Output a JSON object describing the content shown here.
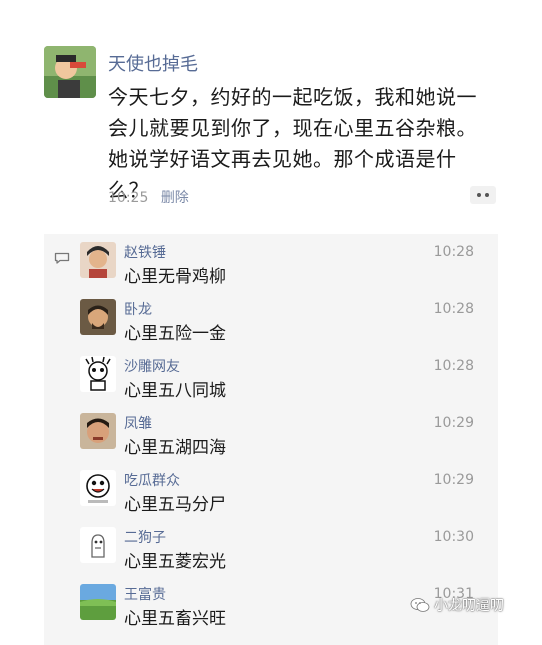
{
  "post": {
    "author": "天使也掉毛",
    "text": "今天七夕，约好的一起吃饭，我和她说一会儿就要见到你了，现在心里五谷杂粮。她说学好语文再去见她。那个成语是什么？",
    "time": "10:25",
    "delete_label": "删除"
  },
  "comments": [
    {
      "name": "赵铁锤",
      "text": "心里无骨鸡柳",
      "time": "10:28"
    },
    {
      "name": "卧龙",
      "text": "心里五险一金",
      "time": "10:28"
    },
    {
      "name": "沙雕网友",
      "text": "心里五八同城",
      "time": "10:28"
    },
    {
      "name": "凤雏",
      "text": "心里五湖四海",
      "time": "10:29"
    },
    {
      "name": "吃瓜群众",
      "text": "心里五马分尸",
      "time": "10:29"
    },
    {
      "name": "二狗子",
      "text": "心里五菱宏光",
      "time": "10:30"
    },
    {
      "name": "王富贵",
      "text": "心里五畜兴旺",
      "time": "10:31"
    }
  ],
  "watermark": "小龙叨逼叨",
  "colors": {
    "name_link": "#576b95",
    "meta_gray": "#9a9a9a",
    "comment_bg": "#f5f5f5"
  }
}
